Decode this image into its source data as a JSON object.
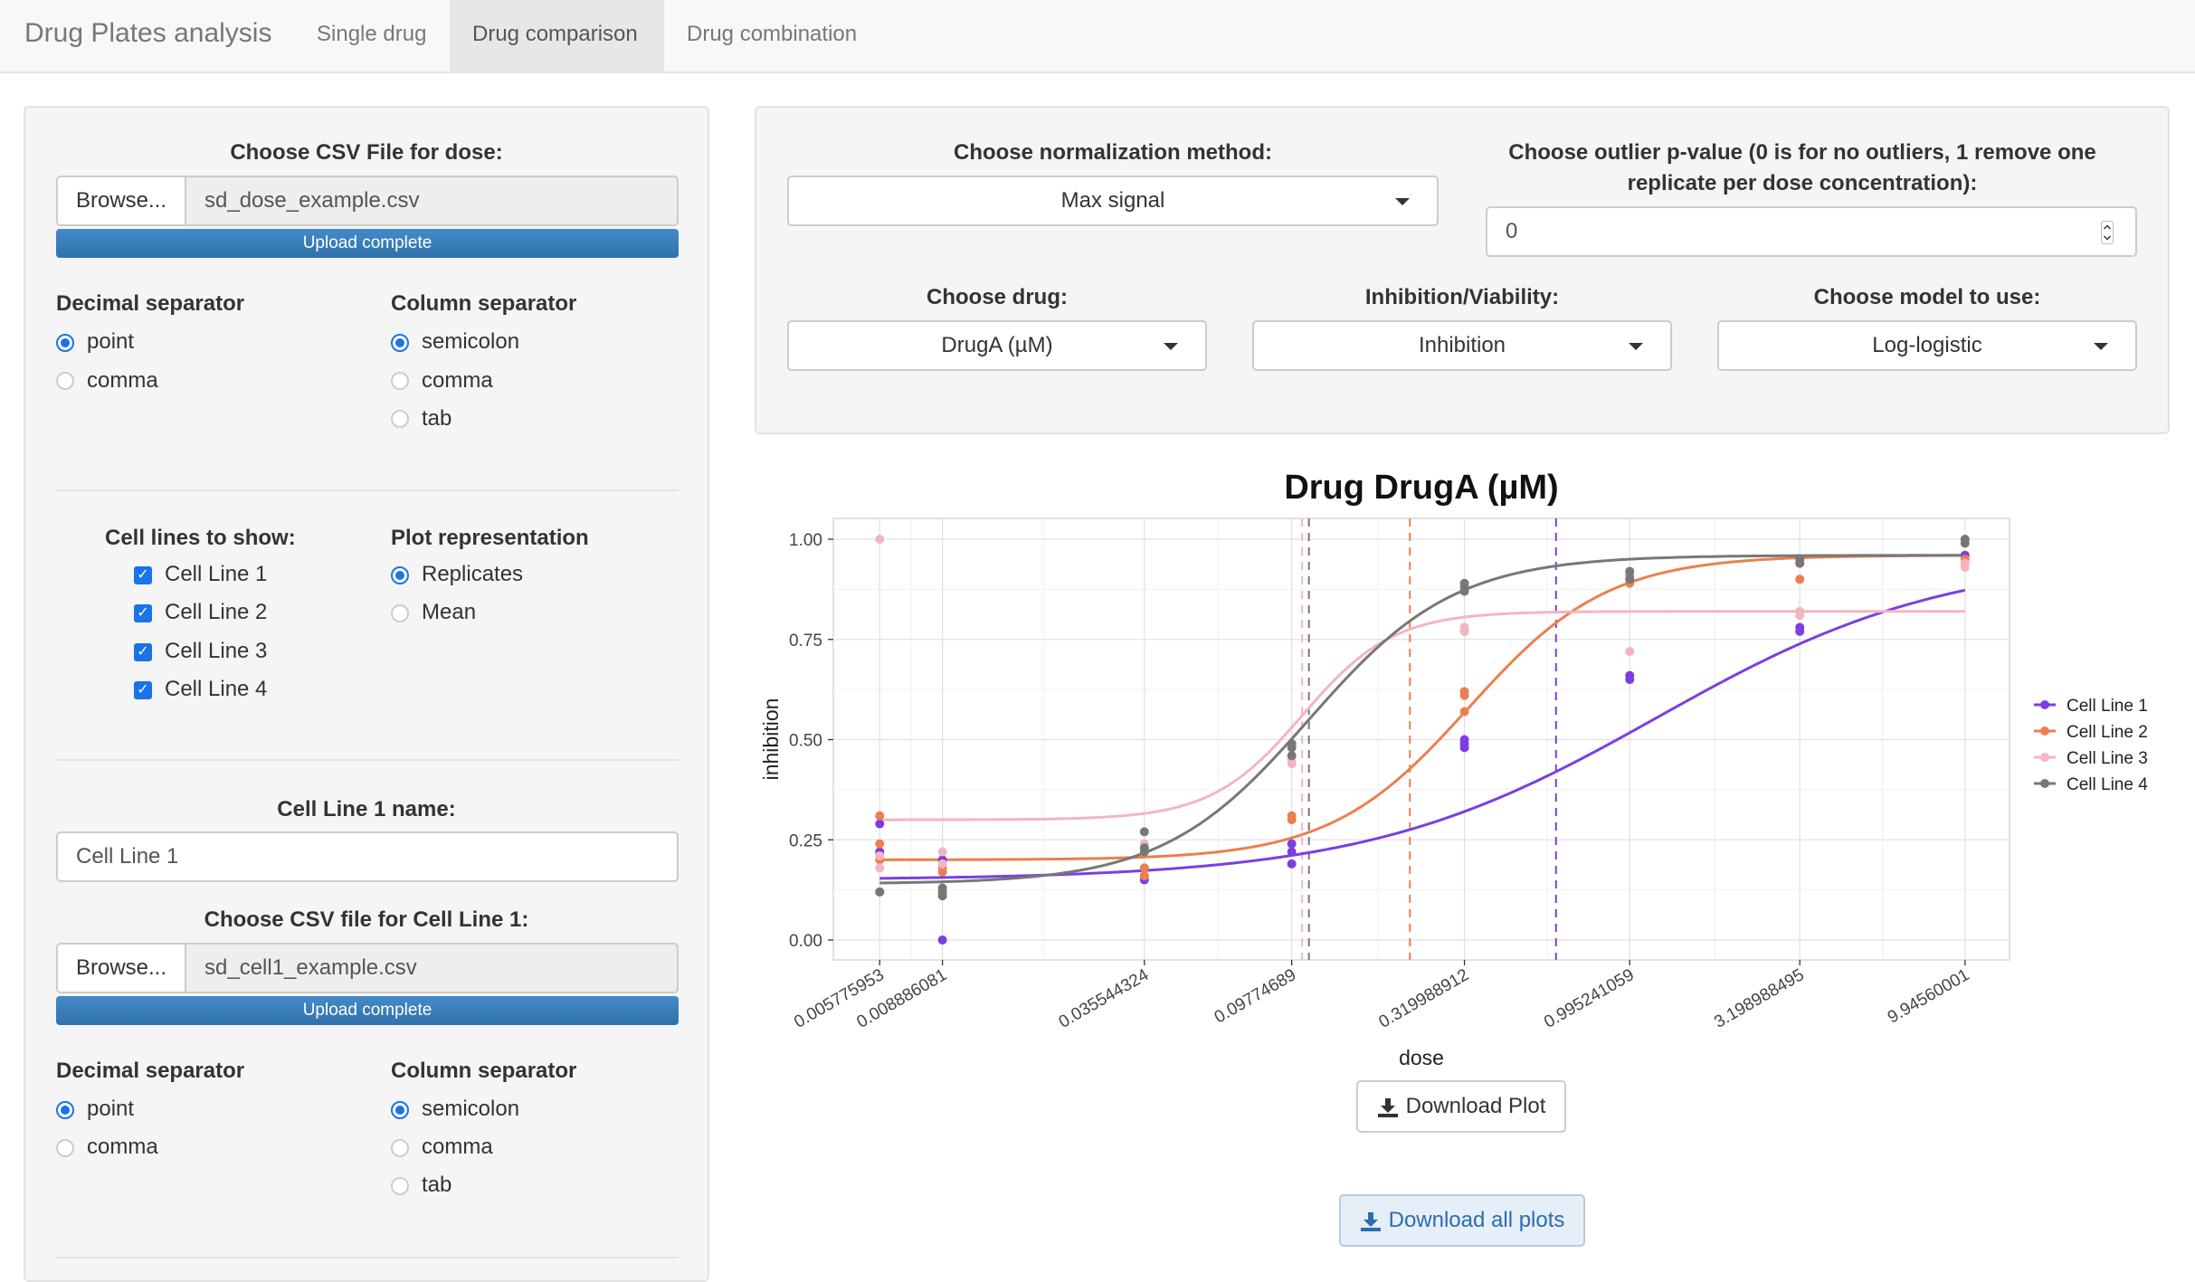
{
  "navbar": {
    "brand": "Drug Plates analysis",
    "tabs": [
      {
        "label": "Single drug",
        "active": false
      },
      {
        "label": "Drug comparison",
        "active": true
      },
      {
        "label": "Drug combination",
        "active": false
      }
    ]
  },
  "sidebar": {
    "dose_file": {
      "label": "Choose CSV File for dose:",
      "browse": "Browse...",
      "filename": "sd_dose_example.csv",
      "progress": "Upload complete",
      "progress_value": 1.0
    },
    "decimal": {
      "label": "Decimal separator",
      "options": [
        "point",
        "comma"
      ],
      "selected": "point"
    },
    "column": {
      "label": "Column separator",
      "options": [
        "semicolon",
        "comma",
        "tab"
      ],
      "selected": "semicolon"
    },
    "cell_lines": {
      "label": "Cell lines to show:",
      "options": [
        "Cell Line 1",
        "Cell Line 2",
        "Cell Line 3",
        "Cell Line 4"
      ],
      "checked": [
        true,
        true,
        true,
        true
      ]
    },
    "plot_rep": {
      "label": "Plot representation",
      "options": [
        "Replicates",
        "Mean"
      ],
      "selected": "Replicates"
    },
    "cell1_name": {
      "label": "Cell Line 1 name:",
      "value": "Cell Line 1"
    },
    "cell1_file": {
      "label": "Choose CSV file for Cell Line 1:",
      "browse": "Browse...",
      "filename": "sd_cell1_example.csv",
      "progress": "Upload complete",
      "progress_value": 1.0
    },
    "decimal2": {
      "label": "Decimal separator",
      "options": [
        "point",
        "comma"
      ],
      "selected": "point"
    },
    "column2": {
      "label": "Column separator",
      "options": [
        "semicolon",
        "comma",
        "tab"
      ],
      "selected": "semicolon"
    }
  },
  "controls": {
    "normalization": {
      "label": "Choose normalization method:",
      "value": "Max signal"
    },
    "outlier": {
      "label_line1": "Choose outlier p-value (0 is for no outliers, 1 remove one",
      "label_line2": "replicate per dose concentration):",
      "value": "0"
    },
    "drug": {
      "label": "Choose drug:",
      "value": "DrugA (µM)"
    },
    "inhibition": {
      "label": "Inhibition/Viability:",
      "value": "Inhibition"
    },
    "model": {
      "label": "Choose model to use:",
      "value": "Log-logistic"
    }
  },
  "buttons": {
    "download_plot": "Download Plot",
    "download_all": "Download all plots"
  },
  "colors": {
    "accent": "#1a73e8",
    "progress": "#337ab7",
    "cell1": "#7b3fe0",
    "cell2": "#ec7f4f",
    "cell3": "#f2b6c1",
    "cell4": "#777777"
  },
  "chart_data": {
    "type": "scatter",
    "title": "Drug DrugA (µM)",
    "xlabel": "dose",
    "ylabel": "inhibition",
    "x_scale": "log",
    "x_ticks": [
      "0.005775953",
      "0.008886081",
      "0.035544324",
      "0.09774689",
      "0.319988912",
      "0.995241059",
      "3.198988495",
      "9.94560001"
    ],
    "x_values": [
      0.005775953,
      0.008886081,
      0.035544324,
      0.09774689,
      0.319988912,
      0.995241059,
      3.198988495,
      9.94560001
    ],
    "y_ticks": [
      "0.00",
      "0.25",
      "0.50",
      "0.75",
      "1.00"
    ],
    "ylim": [
      0,
      1
    ],
    "legend_position": "right",
    "grid": true,
    "series": [
      {
        "name": "Cell Line 1",
        "color": "#7b3fe0",
        "ec50": 0.6,
        "curve": {
          "bottom": 0.15,
          "top": 0.96,
          "ec50": 1.2,
          "hill": 1.0
        },
        "points": [
          [
            0.005775953,
            0.29
          ],
          [
            0.005775953,
            0.22
          ],
          [
            0.008886081,
            0.0
          ],
          [
            0.008886081,
            0.2
          ],
          [
            0.035544324,
            0.15
          ],
          [
            0.035544324,
            0.16
          ],
          [
            0.09774689,
            0.19
          ],
          [
            0.09774689,
            0.22
          ],
          [
            0.09774689,
            0.24
          ],
          [
            0.319988912,
            0.49
          ],
          [
            0.319988912,
            0.48
          ],
          [
            0.319988912,
            0.5
          ],
          [
            0.995241059,
            0.65
          ],
          [
            0.995241059,
            0.66
          ],
          [
            3.198988495,
            0.77
          ],
          [
            3.198988495,
            0.78
          ],
          [
            9.94560001,
            0.96
          ]
        ]
      },
      {
        "name": "Cell Line 2",
        "color": "#ec7f4f",
        "ec50": 0.22,
        "curve": {
          "bottom": 0.2,
          "top": 0.96,
          "ec50": 0.33,
          "hill": 2.1
        },
        "points": [
          [
            0.005775953,
            0.31
          ],
          [
            0.005775953,
            0.24
          ],
          [
            0.005775953,
            0.2
          ],
          [
            0.008886081,
            0.18
          ],
          [
            0.008886081,
            0.17
          ],
          [
            0.035544324,
            0.16
          ],
          [
            0.035544324,
            0.18
          ],
          [
            0.09774689,
            0.3
          ],
          [
            0.09774689,
            0.31
          ],
          [
            0.319988912,
            0.57
          ],
          [
            0.319988912,
            0.61
          ],
          [
            0.319988912,
            0.62
          ],
          [
            0.995241059,
            0.91
          ],
          [
            0.995241059,
            0.89
          ],
          [
            3.198988495,
            0.9
          ],
          [
            3.198988495,
            0.94
          ],
          [
            9.94560001,
            0.95
          ]
        ]
      },
      {
        "name": "Cell Line 3",
        "color": "#f2b6c1",
        "ec50": 0.105,
        "curve": {
          "bottom": 0.3,
          "top": 0.82,
          "ec50": 0.105,
          "hill": 3.2
        },
        "points": [
          [
            0.005775953,
            1.0
          ],
          [
            0.005775953,
            0.18
          ],
          [
            0.005775953,
            0.21
          ],
          [
            0.008886081,
            0.22
          ],
          [
            0.008886081,
            0.19
          ],
          [
            0.035544324,
            0.23
          ],
          [
            0.035544324,
            0.24
          ],
          [
            0.09774689,
            0.44
          ],
          [
            0.09774689,
            0.45
          ],
          [
            0.319988912,
            0.77
          ],
          [
            0.319988912,
            0.78
          ],
          [
            0.995241059,
            0.72
          ],
          [
            3.198988495,
            0.81
          ],
          [
            3.198988495,
            0.82
          ],
          [
            9.94560001,
            0.93
          ],
          [
            9.94560001,
            0.94
          ]
        ]
      },
      {
        "name": "Cell Line 4",
        "color": "#777777",
        "ec50": 0.11,
        "curve": {
          "bottom": 0.14,
          "top": 0.96,
          "ec50": 0.11,
          "hill": 2.0
        },
        "points": [
          [
            0.005775953,
            0.12
          ],
          [
            0.005775953,
            0.12
          ],
          [
            0.008886081,
            0.11
          ],
          [
            0.008886081,
            0.12
          ],
          [
            0.008886081,
            0.13
          ],
          [
            0.035544324,
            0.22
          ],
          [
            0.035544324,
            0.23
          ],
          [
            0.035544324,
            0.27
          ],
          [
            0.09774689,
            0.46
          ],
          [
            0.09774689,
            0.48
          ],
          [
            0.09774689,
            0.49
          ],
          [
            0.319988912,
            0.87
          ],
          [
            0.319988912,
            0.88
          ],
          [
            0.319988912,
            0.89
          ],
          [
            0.995241059,
            0.9
          ],
          [
            0.995241059,
            0.92
          ],
          [
            3.198988495,
            0.94
          ],
          [
            3.198988495,
            0.95
          ],
          [
            9.94560001,
            0.99
          ],
          [
            9.94560001,
            1.0
          ]
        ]
      }
    ]
  }
}
